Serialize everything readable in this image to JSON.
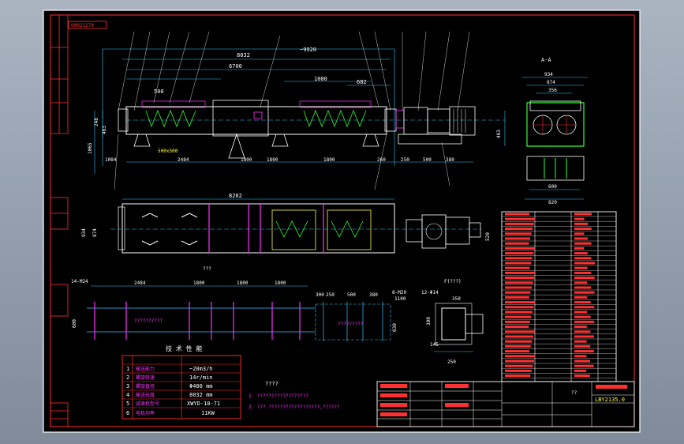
{
  "title_block_id": "00021270",
  "top_view": {
    "dims": [
      "8032",
      "~9920",
      "6700",
      "1000",
      "682",
      "500",
      "1084",
      "2484",
      "1800",
      "1800",
      "1800",
      "260",
      "250",
      "500",
      "380"
    ],
    "vertical_dims": [
      "248",
      "463",
      "1065",
      "463"
    ],
    "inlet_label": "500x500"
  },
  "section_view": {
    "title": "A-A",
    "dims": [
      "934",
      "874",
      "356",
      "600",
      "820"
    ]
  },
  "plan_view": {
    "dims": [
      "8202",
      "934",
      "874",
      "380",
      "380",
      "520"
    ]
  },
  "foundation_view": {
    "dims": [
      "2484",
      "1800",
      "1800",
      "1800",
      "300",
      "250",
      "500",
      "380",
      "1100",
      "600",
      "630"
    ],
    "bolt_labels": [
      "14-M24",
      "8-M20"
    ],
    "center_text": "??????????"
  },
  "detail_view": {
    "title": "F(???)",
    "bolt_label": "12-Φ14",
    "dims": [
      "350",
      "300",
      "145",
      "250"
    ]
  },
  "tech_table": {
    "title": "技 术 性 能",
    "rows": [
      {
        "no": "1",
        "name": "输送能力",
        "value": "~20m3/h"
      },
      {
        "no": "2",
        "name": "螺旋转速",
        "value": "14r/min"
      },
      {
        "no": "3",
        "name": "螺旋直径",
        "value": "Φ400 mm"
      },
      {
        "no": "4",
        "name": "输送长度",
        "value": "8032 mm"
      },
      {
        "no": "5",
        "name": "减速机型号",
        "value": "XWYD-10-71"
      },
      {
        "no": "6",
        "name": "电机功率",
        "value": "11KW"
      }
    ]
  },
  "notes": {
    "heading": "????",
    "lines": [
      "1. ??????????????????",
      "2. ???.??????????????????,??????"
    ]
  },
  "title_block": {
    "drawing_no": "LBY2135.0",
    "sheet": "??"
  },
  "colors": {
    "background": "#000000",
    "frame": "#ff3030",
    "outline": "#ffffff",
    "dimension": "#30c8ff",
    "accent": "#ff30ff",
    "green": "#30ff30",
    "yellow": "#ffff40"
  }
}
